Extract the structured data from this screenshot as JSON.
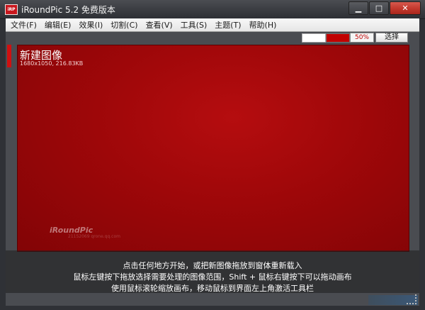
{
  "window": {
    "title": "iRoundPic 5.2 免费版本",
    "app_icon_text": "iRP",
    "minimize_glyph": "▁",
    "maximize_glyph": "□",
    "close_glyph": "✕"
  },
  "menu": {
    "items": [
      {
        "label": "文件(F)"
      },
      {
        "label": "编辑(E)"
      },
      {
        "label": "效果(I)"
      },
      {
        "label": "切割(C)"
      },
      {
        "label": "查看(V)"
      },
      {
        "label": "工具(S)"
      },
      {
        "label": "主题(T)"
      },
      {
        "label": "帮助(H)"
      }
    ]
  },
  "toolbar": {
    "zoom": "50%",
    "select_label": "选择",
    "color_primary": "#ffffff",
    "color_secondary": "#c00000"
  },
  "canvas": {
    "title": "新建图像",
    "info": "1680x1050, 216.83KB",
    "watermark": "iRoundPic",
    "watermark_sub": "21152069 qrone.qq.com"
  },
  "hint": {
    "line1": "点击任何地方开始，或把新图像拖放到窗体重新载入",
    "line2": "鼠标左键按下拖放选择需要处理的图像范围，Shift + 鼠标右键按下可以拖动画布",
    "line3": "使用鼠标滚轮缩放画布，移动鼠标到界面左上角激活工具栏"
  }
}
